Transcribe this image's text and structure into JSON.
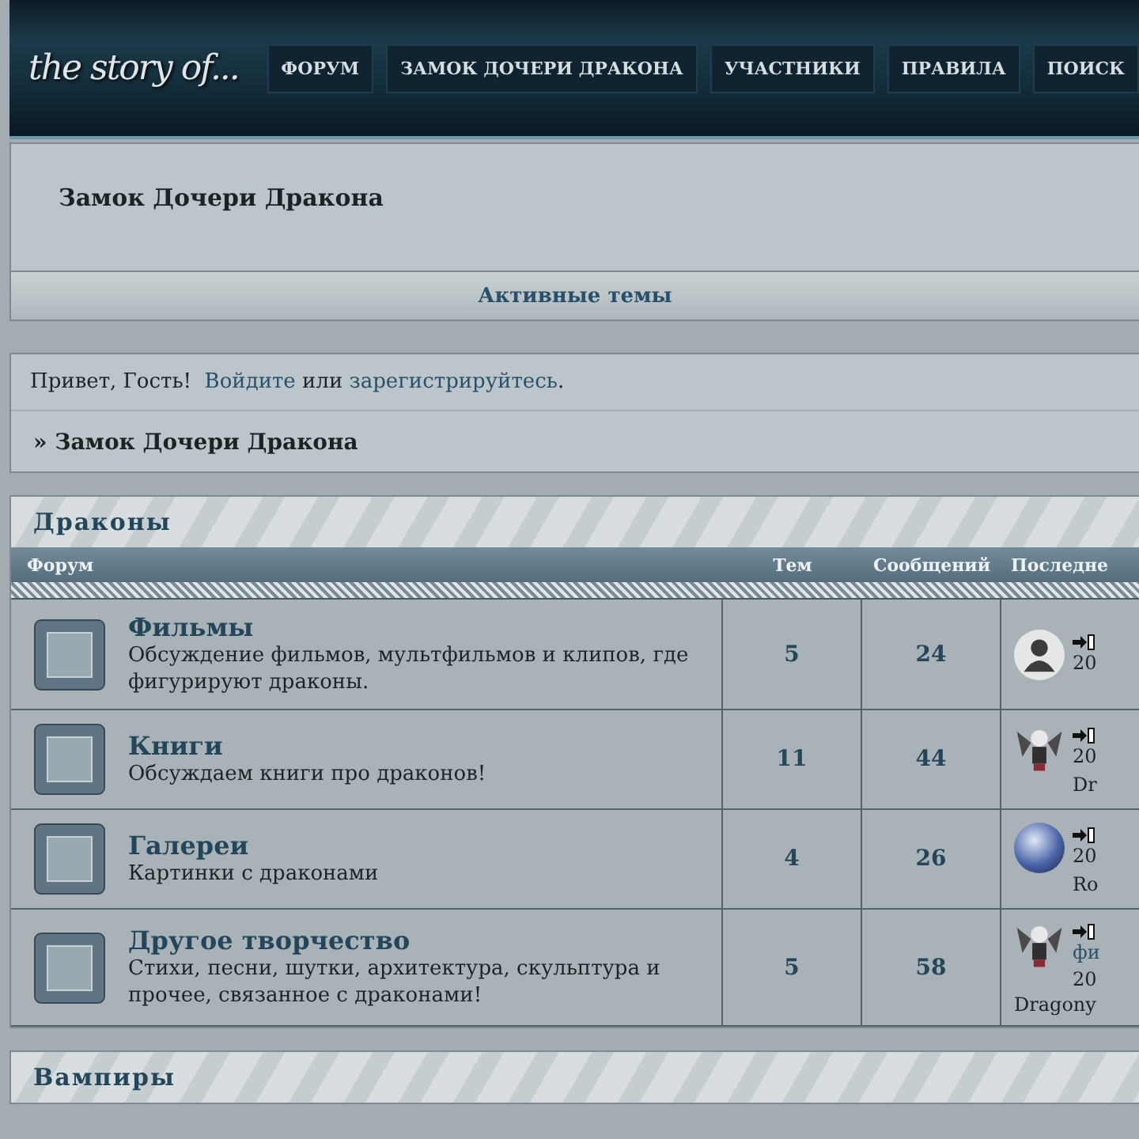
{
  "header": {
    "logo": "the story of...",
    "nav": [
      {
        "label": "ФОРУМ",
        "selected": false
      },
      {
        "label": "ЗАМОК ДОЧЕРИ ДРАКОНА",
        "selected": false
      },
      {
        "label": "УЧАСТНИКИ",
        "selected": false
      },
      {
        "label": "ПРАВИЛА",
        "selected": false
      },
      {
        "label": "ПОИСК",
        "selected": false
      }
    ]
  },
  "board_title": "Замок Дочери Дракона",
  "active_topics_link": "Активные темы",
  "welcome": {
    "greeting": "Привет, Гость!",
    "login_link": "Войдите",
    "or": "или",
    "register_link": "зарегистрируйтесь",
    "end": "."
  },
  "breadcrumb": "» Замок Дочери Дракона",
  "categories": [
    {
      "title": "Драконы",
      "columns": [
        "Форум",
        "Тем",
        "Сообщений",
        "Последне"
      ],
      "forums": [
        {
          "name": "Фильмы",
          "description": "Обсуждение фильмов, мультфильмов и клипов, где фигурируют драконы.",
          "topics": "5",
          "posts": "24",
          "last_post": {
            "kind": "silhouette",
            "lines": [
              "20"
            ]
          }
        },
        {
          "name": "Книги",
          "description": "Обсуждаем книги про драконов!",
          "topics": "11",
          "posts": "44",
          "last_post": {
            "kind": "character",
            "lines": [
              "20",
              "Dr"
            ]
          }
        },
        {
          "name": "Галереи",
          "description": "Картинки с драконами",
          "topics": "4",
          "posts": "26",
          "last_post": {
            "kind": "photo",
            "lines": [
              "20",
              "Ro"
            ]
          }
        },
        {
          "name": "Другое творчество",
          "description": "Стихи, песни, шутки, архитектура, скульптура и прочее, связанное с драконами!",
          "topics": "5",
          "posts": "58",
          "last_post": {
            "kind": "character",
            "link": "фи",
            "lines": [
              "20",
              "Dragony"
            ]
          }
        }
      ]
    },
    {
      "title": "Вампиры"
    }
  ]
}
